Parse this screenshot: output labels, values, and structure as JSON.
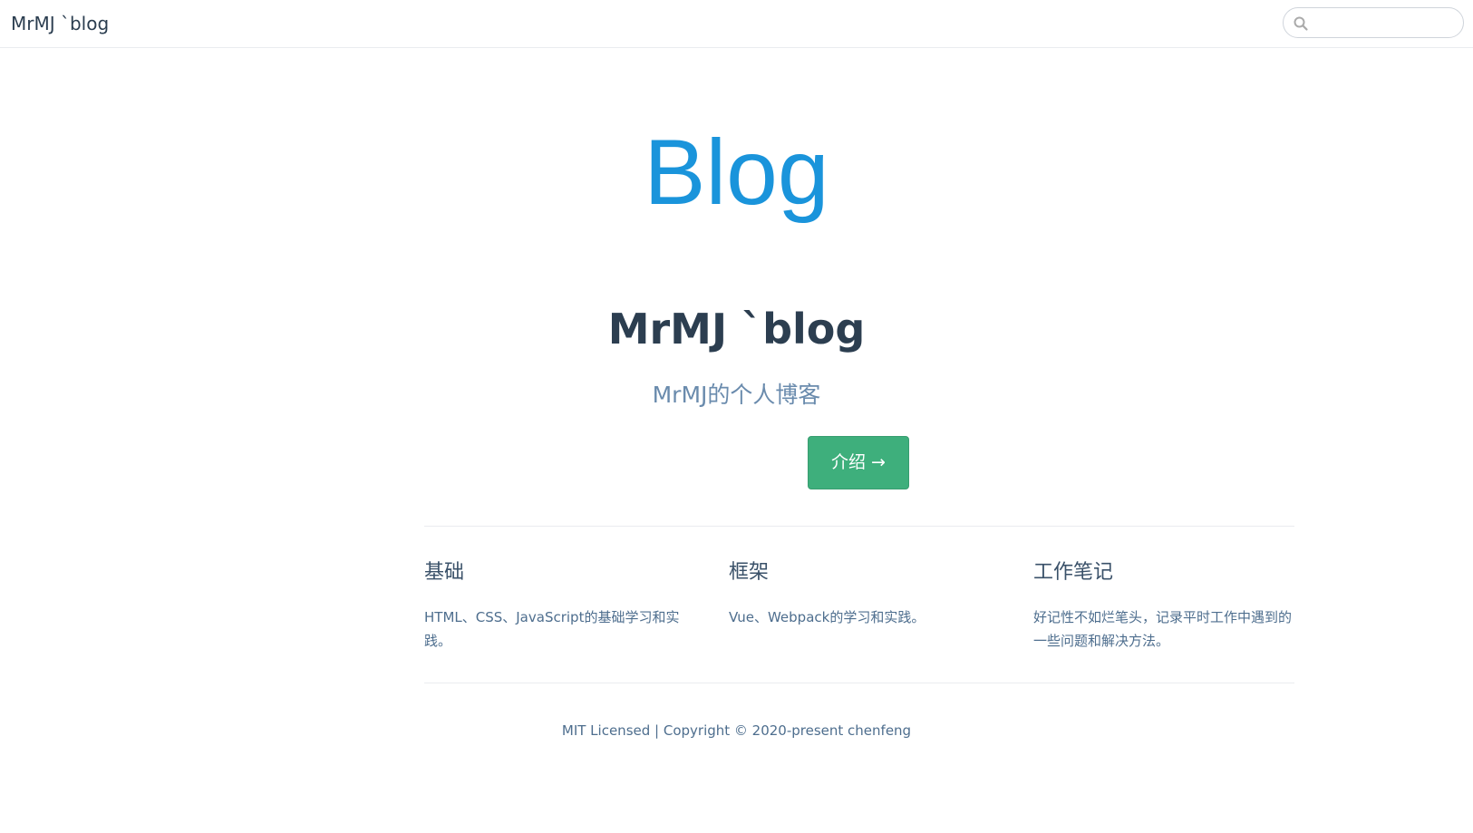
{
  "navbar": {
    "site_name": "MrMJ `blog",
    "search_placeholder": ""
  },
  "hero": {
    "image_text": "Blog",
    "title": "MrMJ `blog",
    "description": "MrMJ的个人博客",
    "action_text": "介绍 →"
  },
  "features": [
    {
      "title": "基础",
      "details": "HTML、CSS、JavaScript的基础学习和实践。"
    },
    {
      "title": "框架",
      "details": "Vue、Webpack的学习和实践。"
    },
    {
      "title": "工作笔记",
      "details": "好记性不如烂笔头，记录平时工作中遇到的一些问题和解决方法。"
    }
  ],
  "footer": {
    "text": "MIT Licensed | Copyright © 2020-present chenfeng"
  },
  "colors": {
    "accent": "#3eaf7c",
    "hero_image": "#1a94db",
    "text": "#2c3e50",
    "description": "#6a8bad"
  }
}
